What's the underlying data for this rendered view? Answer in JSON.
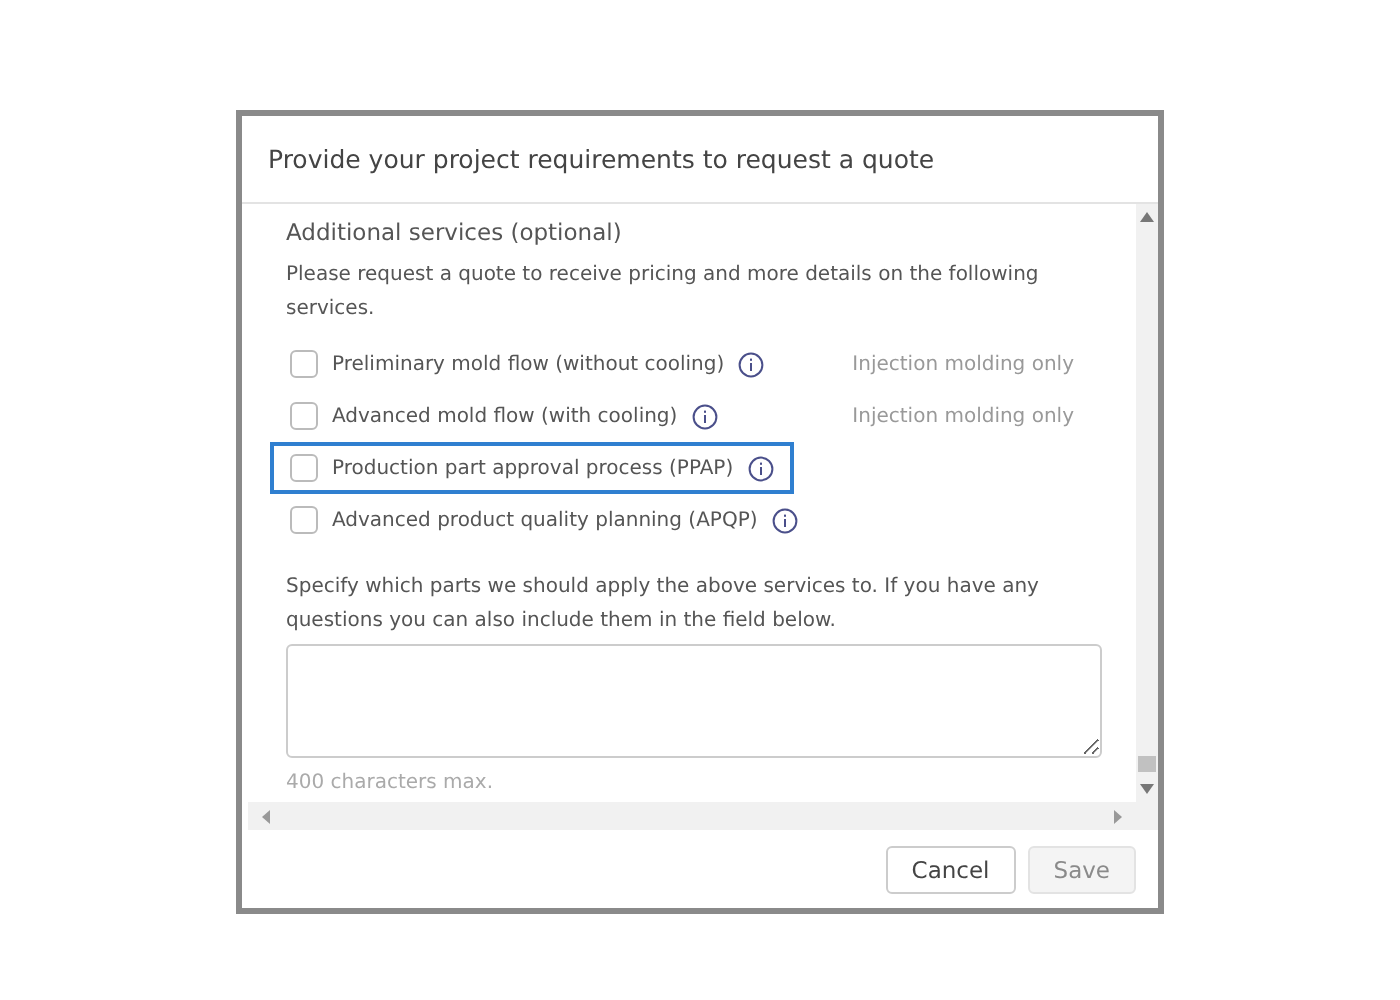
{
  "dialog": {
    "title": "Provide your project requirements to request a quote"
  },
  "section": {
    "heading": "Additional services (optional)",
    "intro": "Please request a quote to receive pricing and more details on the following services."
  },
  "options": [
    {
      "label": "Preliminary mold flow (without cooling)",
      "checked": false,
      "highlighted": false,
      "note": "Injection molding only"
    },
    {
      "label": "Advanced mold flow (with cooling)",
      "checked": false,
      "highlighted": false,
      "note": "Injection molding only"
    },
    {
      "label": "Production part approval process (PPAP)",
      "checked": false,
      "highlighted": true
    },
    {
      "label": "Advanced product quality planning (APQP)",
      "checked": false,
      "highlighted": false
    }
  ],
  "notes": {
    "prompt": "Specify which parts we should apply the above services to. If you have any questions you can also include them in the field below.",
    "hint": "400 characters max."
  },
  "buttons": [
    {
      "label": "Cancel",
      "disabled": false
    },
    {
      "label": "Save",
      "disabled": true
    }
  ]
}
